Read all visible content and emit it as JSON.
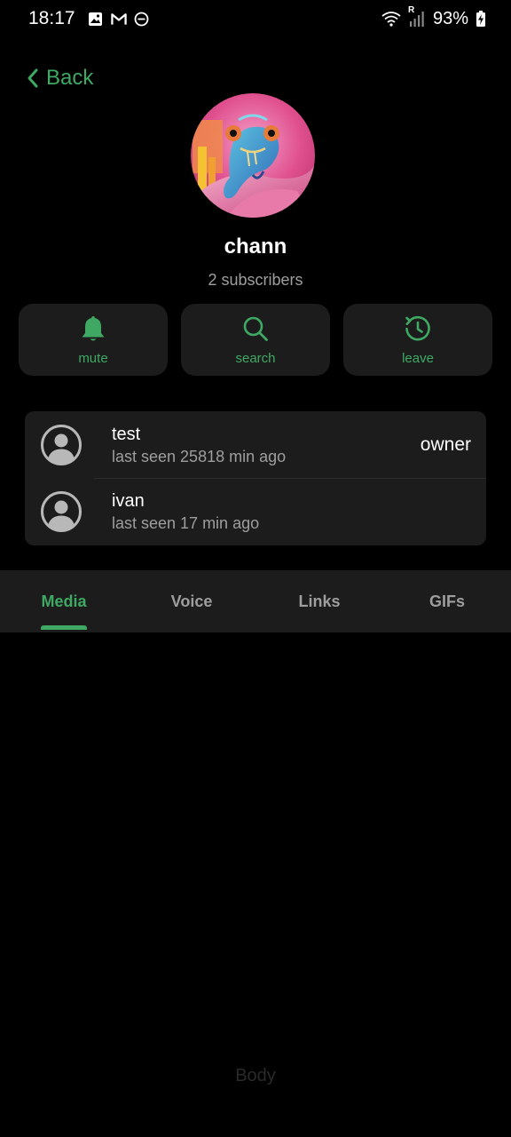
{
  "status_bar": {
    "time": "18:17",
    "battery": "93%",
    "left_icons": [
      "image-icon",
      "gmail-icon",
      "do-not-disturb-icon"
    ],
    "right_icons": [
      "wifi-icon",
      "signal-icon",
      "battery-charging-icon"
    ],
    "signal_roaming_label": "R"
  },
  "header": {
    "back_label": "Back"
  },
  "channel": {
    "name": "chann",
    "subscribers": "2 subscribers"
  },
  "actions": [
    {
      "label": "mute",
      "icon": "bell-icon"
    },
    {
      "label": "search",
      "icon": "search-icon"
    },
    {
      "label": "leave",
      "icon": "leave-icon"
    }
  ],
  "members": [
    {
      "name": "test",
      "status": "last seen 25818 min ago",
      "role": "owner"
    },
    {
      "name": "ivan",
      "status": "last seen 17 min ago",
      "role": ""
    }
  ],
  "tabs": [
    {
      "label": "Media",
      "active": true
    },
    {
      "label": "Voice",
      "active": false
    },
    {
      "label": "Links",
      "active": false
    },
    {
      "label": "GIFs",
      "active": false
    }
  ],
  "body_placeholder": "Body",
  "colors": {
    "accent": "#3fa964",
    "background": "#000000",
    "card": "#1c1c1c",
    "secondary_text": "#9e9e9e"
  }
}
